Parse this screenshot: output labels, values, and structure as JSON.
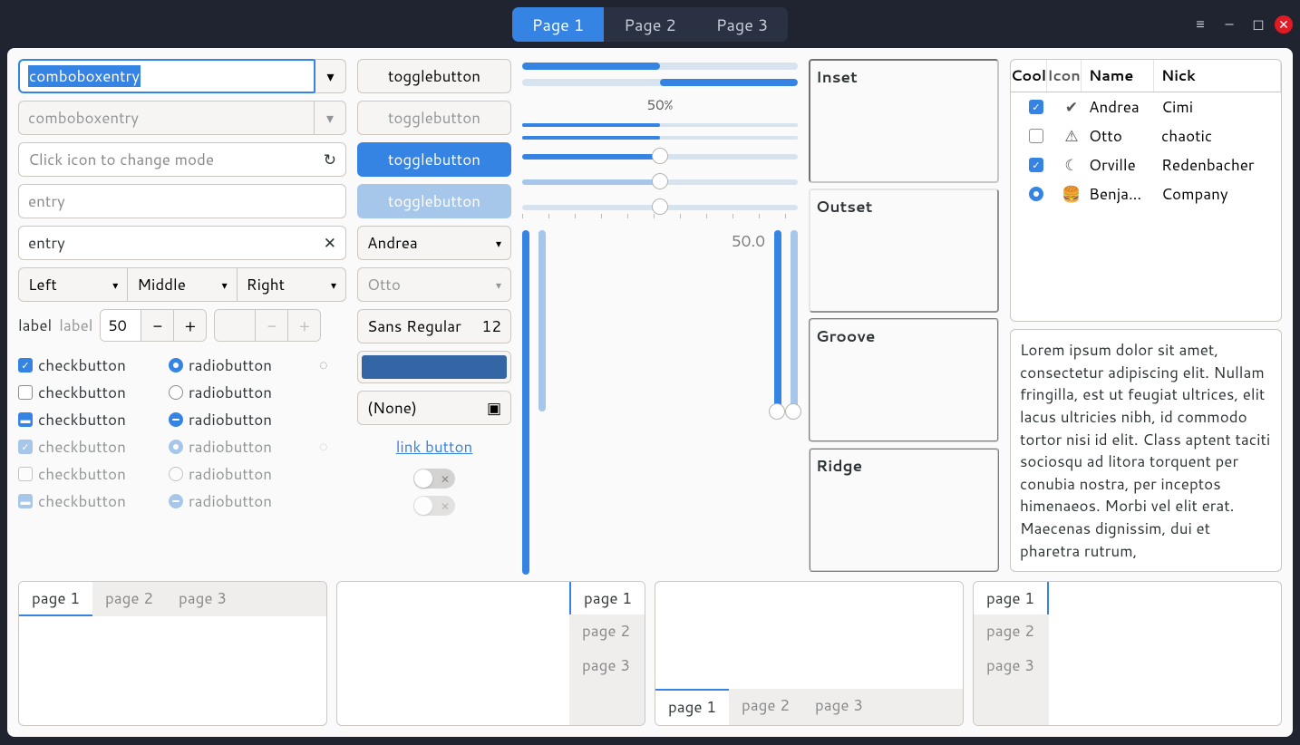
{
  "titlebar": {
    "tabs": [
      "Page 1",
      "Page 2",
      "Page 3"
    ],
    "active_index": 0
  },
  "col1": {
    "combobox_entry_value": "comboboxentry",
    "combobox_entry_disabled_value": "comboboxentry",
    "mode_entry_placeholder": "Click icon to change mode",
    "entry_placeholder": "entry",
    "entry_with_clear_value": "entry",
    "segmented": [
      "Left",
      "Middle",
      "Right"
    ],
    "label1": "label",
    "label2_disabled": "label",
    "spin_value": "50",
    "checkbutton_label": "checkbutton",
    "radiobutton_label": "radiobutton"
  },
  "col2": {
    "togglebutton_label": "togglebutton",
    "dropdown1": "Andrea",
    "dropdown2_disabled": "Otto",
    "font_name": "Sans Regular",
    "font_size": "12",
    "color_value": "#3465a4",
    "file_none": "(None)",
    "link_label": "link button"
  },
  "progress": {
    "p1_pct": 50,
    "p2_pct_right": 50,
    "label_50pct": "50%",
    "p3_pct": 50,
    "p4_pct": 50,
    "slider1_pct": 50,
    "slider2_pct": 50,
    "slider3_pct": 50,
    "vslider_value_label": "50.0"
  },
  "frames": {
    "inset": "Inset",
    "outset": "Outset",
    "groove": "Groove",
    "ridge": "Ridge"
  },
  "treeview": {
    "columns": [
      "Cool",
      "Icon",
      "Name",
      "Nick"
    ],
    "rows": [
      {
        "cool_checked": true,
        "cool_type": "checkbox",
        "icon": "check-circle",
        "name": "Andrea",
        "nick": "Cimi"
      },
      {
        "cool_checked": false,
        "cool_type": "checkbox",
        "icon": "alert",
        "name": "Otto",
        "nick": "chaotic"
      },
      {
        "cool_checked": true,
        "cool_type": "checkbox",
        "icon": "moon",
        "name": "Orville",
        "nick": "Redenbacher"
      },
      {
        "cool_checked": true,
        "cool_type": "radio",
        "icon": "hamburger",
        "name": "Benja...",
        "nick": "Company"
      }
    ]
  },
  "textview": "Lorem ipsum dolor sit amet, consectetur adipiscing elit.\nNullam fringilla, est ut feugiat ultrices, elit lacus ultricies nibh, id commodo tortor nisi id elit.\nClass aptent taciti sociosqu ad litora torquent per conubia nostra, per inceptos himenaeos.\nMorbi vel elit erat. Maecenas dignissim, dui et pharetra rutrum,",
  "notebooks": {
    "pages": [
      "page 1",
      "page 2",
      "page 3"
    ],
    "active_index": 0
  }
}
